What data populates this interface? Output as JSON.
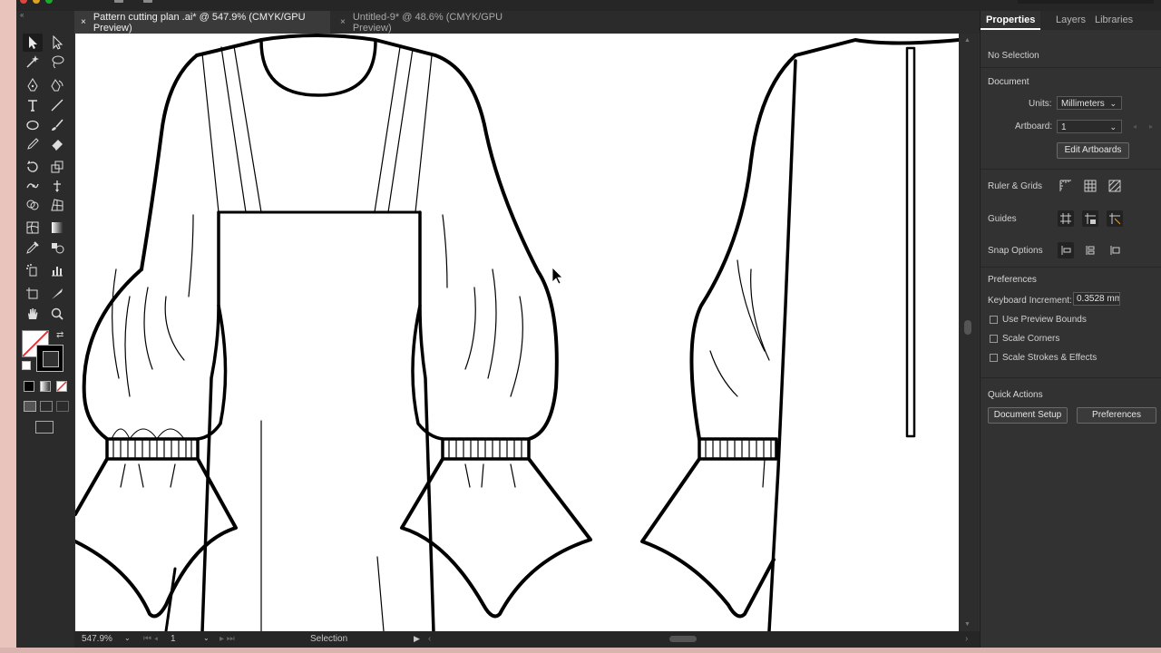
{
  "tabs": [
    {
      "title": "Pattern cutting plan .ai* @ 547.9% (CMYK/GPU Preview)",
      "close": "×"
    },
    {
      "title": "Untitled-9* @ 48.6% (CMYK/GPU Preview)",
      "close": "×"
    }
  ],
  "toolbar": {
    "collapse": "«",
    "tools": [
      "selection",
      "direct-selection",
      "magic-wand",
      "lasso",
      "pen",
      "curvature",
      "type",
      "line",
      "ellipse",
      "paintbrush",
      "pencil",
      "eraser",
      "rotate",
      "scale",
      "puppet-warp",
      "free-transform",
      "shape-builder",
      "perspective-grid",
      "mesh",
      "gradient",
      "eyedropper",
      "blend",
      "symbol-sprayer",
      "column-graph",
      "artboard",
      "slice",
      "hand",
      "zoom"
    ]
  },
  "colors": {
    "fill": "#ffffff",
    "stroke": "#000000",
    "accent": "#ffffff",
    "none": "#e03030"
  },
  "status": {
    "zoom": "547.9%",
    "artboard": "1",
    "tool": "Selection"
  },
  "panel": {
    "tabs": [
      "Properties",
      "Layers",
      "Libraries"
    ],
    "selection": "No Selection",
    "document": {
      "heading": "Document",
      "units_label": "Units:",
      "units_value": "Millimeters",
      "artboard_label": "Artboard:",
      "artboard_value": "1",
      "edit_artboards": "Edit Artboards"
    },
    "ruler_grids": "Ruler & Grids",
    "guides": "Guides",
    "snap_options": "Snap Options",
    "preferences": {
      "heading": "Preferences",
      "keyboard_increment_label": "Keyboard Increment:",
      "keyboard_increment_value": "0.3528 mm",
      "use_preview_bounds": "Use Preview Bounds",
      "scale_corners": "Scale Corners",
      "scale_strokes": "Scale Strokes & Effects"
    },
    "quick_actions": {
      "heading": "Quick Actions",
      "document_setup": "Document Setup",
      "preferences": "Preferences"
    }
  }
}
